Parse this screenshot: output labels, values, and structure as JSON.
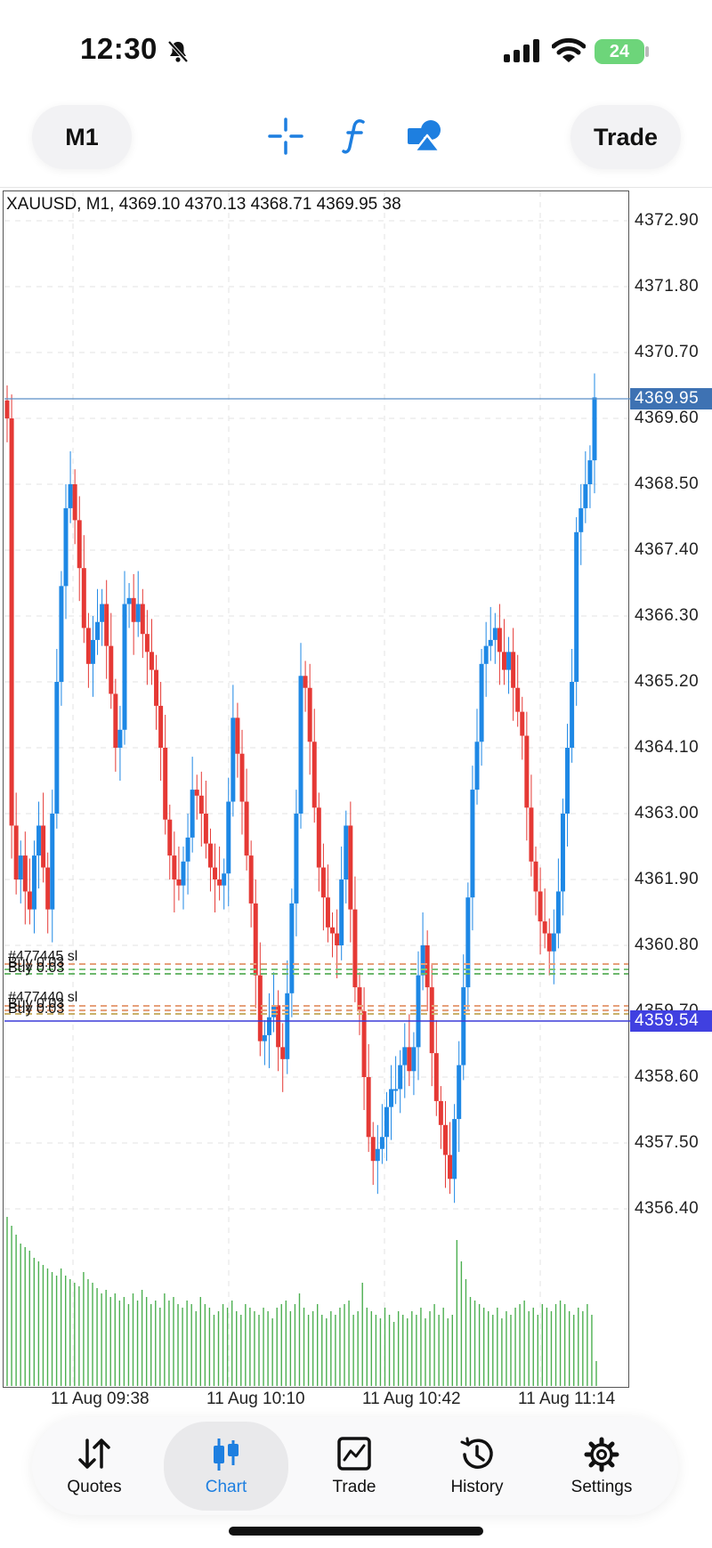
{
  "status_bar": {
    "time": "12:30",
    "battery": "24"
  },
  "toolbar": {
    "timeframe": "M1",
    "trade_label": "Trade",
    "tools": [
      "crosshair-icon",
      "function-icon",
      "objects-icon"
    ]
  },
  "chart": {
    "info_line": "XAUUSD, M1, 4369.10 4370.13 4368.71 4369.95 38",
    "price_levels": [
      "4372.90",
      "4371.80",
      "4370.70",
      "4369.60",
      "4368.50",
      "4367.40",
      "4366.30",
      "4365.20",
      "4364.10",
      "4363.00",
      "4361.90",
      "4360.80",
      "4359.70",
      "4358.60",
      "4357.50",
      "4356.40"
    ],
    "current_bid": "4369.95",
    "ask_line": "4359.54",
    "time_labels": [
      "11 Aug 09:38",
      "11 Aug 10:10",
      "11 Aug 10:42",
      "11 Aug 11:14"
    ],
    "order_labels_top": [
      "#477445 sl",
      "Buy 0.03",
      "Buy 0.03"
    ],
    "order_labels_bottom": [
      "#477440 sl",
      "Buy 0.03",
      "Buy 0.03"
    ],
    "colors": {
      "bull": "#1e88e5",
      "bear": "#e53935",
      "volume": "#4caf50",
      "bid_line": "#5b8fc7",
      "ask_line": "#3b3bd9"
    }
  },
  "chart_data": {
    "type": "candlestick",
    "symbol": "XAUUSD",
    "timeframe": "M1",
    "ylim": [
      4355.4,
      4373.4
    ],
    "x_ticks": [
      "11 Aug 09:38",
      "11 Aug 10:10",
      "11 Aug 10:42",
      "11 Aug 11:14"
    ],
    "close": [
      4369.6,
      4362.8,
      4361.9,
      4362.3,
      4361.7,
      4361.4,
      4362.3,
      4362.8,
      4362.1,
      4361.4,
      4363.0,
      4365.2,
      4366.8,
      4368.1,
      4368.5,
      4367.9,
      4367.1,
      4366.1,
      4365.5,
      4365.9,
      4366.2,
      4366.5,
      4365.8,
      4365.0,
      4364.1,
      4364.4,
      4366.5,
      4366.6,
      4366.2,
      4366.5,
      4366.0,
      4365.7,
      4365.4,
      4364.8,
      4364.1,
      4362.9,
      4362.3,
      4361.9,
      4361.8,
      4362.2,
      4362.6,
      4363.4,
      4363.3,
      4363.0,
      4362.5,
      4362.1,
      4361.9,
      4361.8,
      4362.0,
      4363.2,
      4364.6,
      4364.0,
      4363.2,
      4362.3,
      4361.5,
      4360.3,
      4359.2,
      4359.3,
      4359.6,
      4359.8,
      4359.1,
      4358.9,
      4360.0,
      4361.5,
      4363.0,
      4365.3,
      4365.1,
      4364.2,
      4363.1,
      4362.1,
      4361.6,
      4361.1,
      4361.0,
      4360.8,
      4361.9,
      4362.8,
      4361.4,
      4360.1,
      4359.7,
      4358.6,
      4357.6,
      4357.2,
      4357.4,
      4357.6,
      4358.1,
      4358.4,
      4358.4,
      4358.8,
      4359.1,
      4358.7,
      4359.1,
      4360.3,
      4360.8,
      4360.1,
      4359.0,
      4358.2,
      4357.8,
      4357.3,
      4356.9,
      4357.9,
      4358.8,
      4360.1,
      4361.6,
      4363.4,
      4364.2,
      4365.5,
      4365.8,
      4365.9,
      4366.1,
      4365.7,
      4365.4,
      4365.7,
      4365.1,
      4364.7,
      4364.3,
      4363.1,
      4362.2,
      4361.7,
      4361.2,
      4361.0,
      4360.7,
      4361.0,
      4361.7,
      4363.0,
      4364.1,
      4365.2,
      4367.7,
      4368.1,
      4368.5,
      4368.9,
      4369.95
    ],
    "volume": [
      95,
      90,
      85,
      80,
      78,
      76,
      72,
      70,
      68,
      66,
      64,
      62,
      66,
      62,
      60,
      58,
      56,
      64,
      60,
      58,
      55,
      52,
      54,
      50,
      52,
      48,
      50,
      46,
      52,
      48,
      54,
      50,
      46,
      48,
      44,
      52,
      48,
      50,
      46,
      44,
      48,
      46,
      42,
      50,
      46,
      44,
      40,
      42,
      46,
      44,
      48,
      42,
      40,
      46,
      44,
      42,
      40,
      44,
      42,
      38,
      44,
      46,
      48,
      42,
      46,
      52,
      44,
      40,
      42,
      46,
      40,
      38,
      42,
      40,
      44,
      46,
      48,
      40,
      42,
      58,
      44,
      42,
      40,
      38,
      44,
      40,
      36,
      42,
      40,
      38,
      42,
      40,
      44,
      38,
      42,
      46,
      40,
      44,
      38,
      40,
      82,
      70,
      60,
      50,
      48,
      46,
      44,
      42,
      40,
      44,
      38,
      42,
      40,
      44,
      46,
      48,
      42,
      44,
      40,
      46,
      44,
      42,
      46,
      48,
      46,
      42,
      40,
      44,
      42,
      46,
      40,
      14
    ]
  },
  "bottom_nav": {
    "items": [
      {
        "label": "Quotes",
        "icon": "quotes-arrows-icon"
      },
      {
        "label": "Chart",
        "icon": "chart-candles-icon"
      },
      {
        "label": "Trade",
        "icon": "trade-chart-icon"
      },
      {
        "label": "History",
        "icon": "history-clock-icon"
      },
      {
        "label": "Settings",
        "icon": "gear-icon"
      }
    ],
    "active": "Chart",
    "active_color": "#1e7fe0"
  }
}
